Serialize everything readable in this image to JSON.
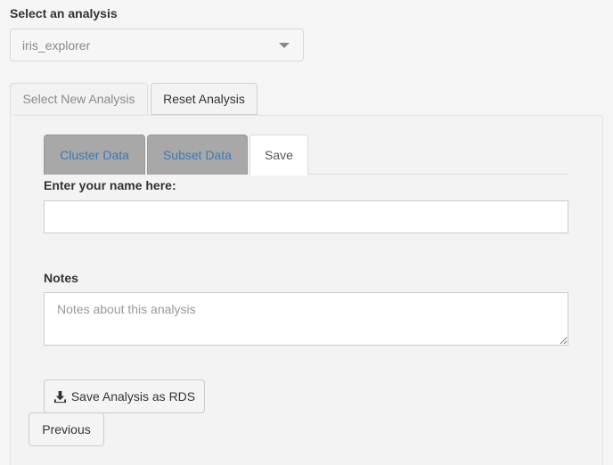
{
  "select": {
    "label": "Select an analysis",
    "value": "iris_explorer"
  },
  "top_tabs": [
    {
      "label": "Select New Analysis"
    },
    {
      "label": "Reset Analysis"
    }
  ],
  "inner_tabs": [
    {
      "label": "Cluster Data"
    },
    {
      "label": "Subset Data"
    },
    {
      "label": "Save",
      "active": true
    }
  ],
  "form": {
    "name_label": "Enter your name here:",
    "name_value": "",
    "notes_label": "Notes",
    "notes_placeholder": "Notes about this analysis"
  },
  "buttons": {
    "save_rds": "Save Analysis as RDS",
    "previous": "Previous"
  },
  "icons": {
    "select_caret": "chevron-down-icon",
    "save_rds": "download-icon"
  }
}
